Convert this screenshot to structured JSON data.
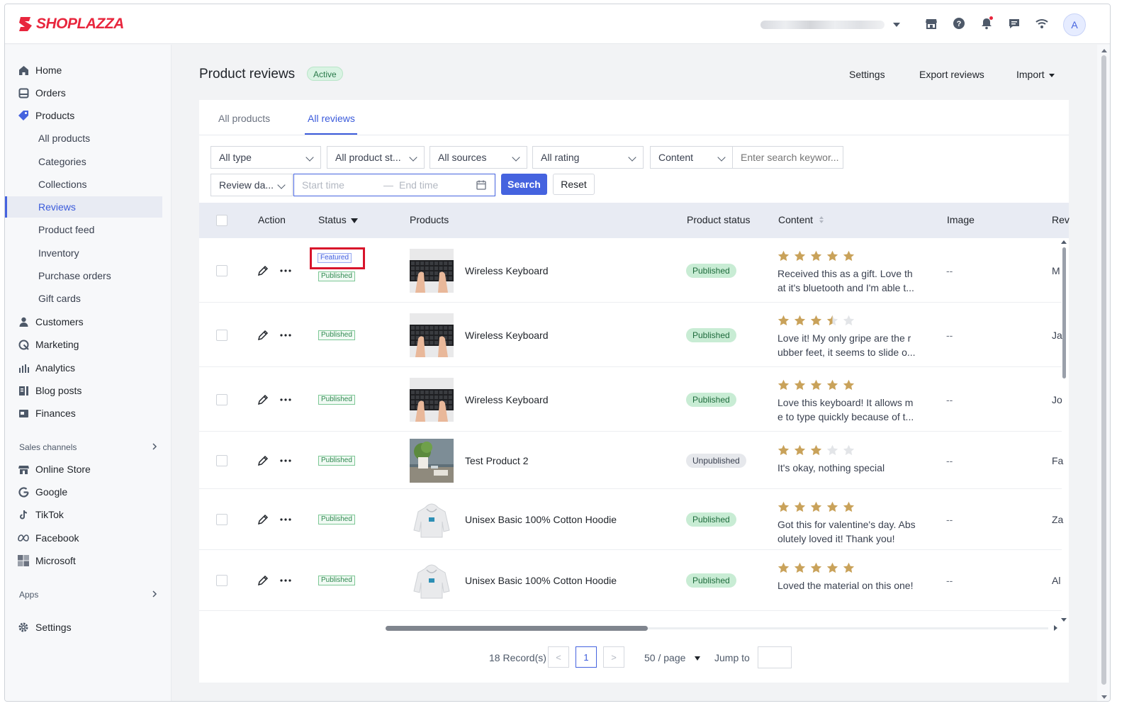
{
  "brand": {
    "name": "SHOPLAZZA",
    "color": "#e8263d",
    "accent": "#4563df"
  },
  "topbar": {
    "icons": [
      "store-icon",
      "help-icon",
      "bell-icon",
      "chat-icon",
      "wifi-icon"
    ],
    "avatar_initial": "A"
  },
  "sidebar": {
    "items": [
      {
        "label": "Home",
        "icon": "home-icon"
      },
      {
        "label": "Orders",
        "icon": "orders-icon"
      },
      {
        "label": "Products",
        "icon": "tag-icon"
      },
      {
        "label": "All products"
      },
      {
        "label": "Categories"
      },
      {
        "label": "Collections"
      },
      {
        "label": "Reviews"
      },
      {
        "label": "Product feed"
      },
      {
        "label": "Inventory"
      },
      {
        "label": "Purchase orders"
      },
      {
        "label": "Gift cards"
      },
      {
        "label": "Customers",
        "icon": "user-icon"
      },
      {
        "label": "Marketing",
        "icon": "marketing-icon"
      },
      {
        "label": "Analytics",
        "icon": "analytics-icon"
      },
      {
        "label": "Blog posts",
        "icon": "blog-icon"
      },
      {
        "label": "Finances",
        "icon": "finances-icon"
      }
    ],
    "sales_channels_title": "Sales channels",
    "channels": [
      {
        "label": "Online Store",
        "icon": "store-icon"
      },
      {
        "label": "Google",
        "icon": "google-icon"
      },
      {
        "label": "TikTok",
        "icon": "tiktok-icon"
      },
      {
        "label": "Facebook",
        "icon": "meta-icon"
      },
      {
        "label": "Microsoft",
        "icon": "microsoft-icon"
      }
    ],
    "apps_title": "Apps",
    "settings_label": "Settings"
  },
  "header": {
    "title": "Product reviews",
    "badge": "Active",
    "settings": "Settings",
    "export": "Export reviews",
    "import": "Import"
  },
  "tabs": [
    "All products",
    "All reviews"
  ],
  "filters": {
    "type": "All type",
    "product_status": "All product st...",
    "sources": "All sources",
    "rating": "All rating",
    "content": "Content",
    "search_placeholder": "Enter search keywor...",
    "review_date": "Review da...",
    "start_placeholder": "Start time",
    "end_placeholder": "End time",
    "search_btn": "Search",
    "reset_btn": "Reset"
  },
  "table": {
    "columns": [
      "Action",
      "Status",
      "Products",
      "Product status",
      "Content",
      "Image",
      "Rev"
    ],
    "rows": [
      {
        "featured": "Featured",
        "status": "Published",
        "product": "Wireless Keyboard",
        "product_status": "Published",
        "rating": 5,
        "content": "Received this as a gift. Love that it's bluetooth and I'm able t...",
        "image": "--",
        "reviewer": "M"
      },
      {
        "status": "Published",
        "product": "Wireless Keyboard",
        "product_status": "Published",
        "rating": 3.5,
        "content": "Love it! My only gripe are the rubber feet, it seems to slide o...",
        "image": "--",
        "reviewer": "Ja"
      },
      {
        "status": "Published",
        "product": "Wireless Keyboard",
        "product_status": "Published",
        "rating": 5,
        "content": "Love this keyboard! It allows me to type quickly because of t...",
        "image": "--",
        "reviewer": "Jo"
      },
      {
        "status": "Published",
        "product": "Test Product 2",
        "product_status": "Unpublished",
        "rating": 3,
        "content": "It's okay, nothing special",
        "image": "--",
        "reviewer": "Fa"
      },
      {
        "status": "Published",
        "product": "Unisex Basic 100% Cotton Hoodie",
        "product_status": "Published",
        "rating": 5,
        "content": "Got this for valentine's day. Absolutely loved it! Thank you!",
        "image": "--",
        "reviewer": "Za"
      },
      {
        "status": "Published",
        "product": "Unisex Basic 100% Cotton Hoodie",
        "product_status": "Published",
        "rating": 5,
        "content": "Loved the material on this one!",
        "image": "--",
        "reviewer": "Al"
      }
    ]
  },
  "pagination": {
    "records": "18 Record(s)",
    "current": "1",
    "per_page": "50 / page",
    "jump_to": "Jump to"
  }
}
